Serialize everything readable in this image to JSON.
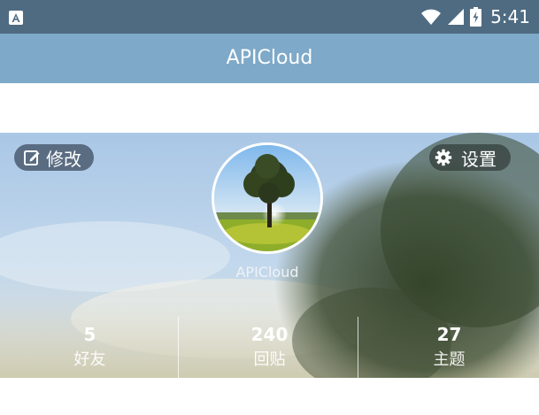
{
  "status_bar": {
    "time": "5:41",
    "icons": [
      "app-notification-icon",
      "wifi-icon",
      "signal-icon",
      "battery-icon"
    ]
  },
  "title_bar": {
    "title": "APICloud"
  },
  "profile": {
    "edit_label": "修改",
    "settings_label": "设置",
    "username": "APICloud",
    "stats": [
      {
        "value": "5",
        "label": "好友"
      },
      {
        "value": "240",
        "label": "回贴"
      },
      {
        "value": "27",
        "label": "主题"
      }
    ]
  },
  "colors": {
    "status_bar": "#4f6b81",
    "title_bar": "#7ea9c8",
    "button_bg": "#4b5c70"
  }
}
